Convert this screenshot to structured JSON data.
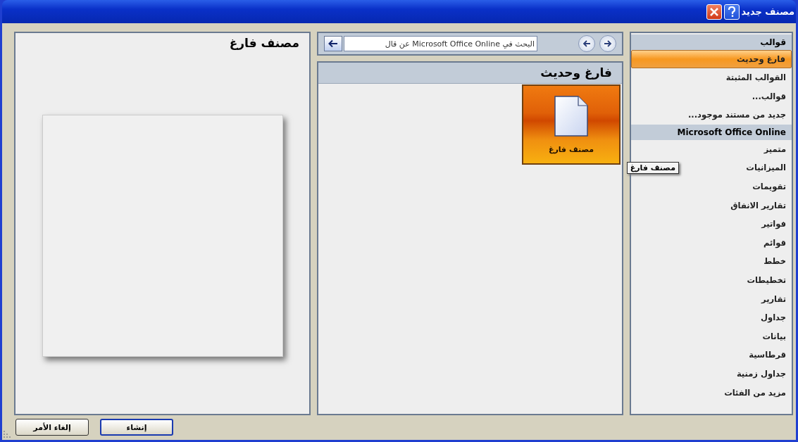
{
  "window": {
    "title": "مصنف جديد"
  },
  "sidebar": {
    "items": [
      {
        "kind": "heading",
        "label": "قوالب",
        "selected": false
      },
      {
        "kind": "item",
        "label": "فارغ وحديث",
        "selected": true
      },
      {
        "kind": "item",
        "label": "القوالب المثبتة",
        "selected": false
      },
      {
        "kind": "item",
        "label": "قوالب...",
        "selected": false
      },
      {
        "kind": "item",
        "label": "جديد من مستند موجود...",
        "selected": false
      },
      {
        "kind": "heading",
        "label": "Microsoft Office Online",
        "selected": false
      },
      {
        "kind": "item",
        "label": "متميز",
        "selected": false
      },
      {
        "kind": "item",
        "label": "الميزانيات",
        "selected": false
      },
      {
        "kind": "item",
        "label": "تقويمات",
        "selected": false
      },
      {
        "kind": "item",
        "label": "تقارير الانفاق",
        "selected": false
      },
      {
        "kind": "item",
        "label": "فواتير",
        "selected": false
      },
      {
        "kind": "item",
        "label": "قوائم",
        "selected": false
      },
      {
        "kind": "item",
        "label": "خطط",
        "selected": false
      },
      {
        "kind": "item",
        "label": "تخطيطات",
        "selected": false
      },
      {
        "kind": "item",
        "label": "تقارير",
        "selected": false
      },
      {
        "kind": "item",
        "label": "جداول",
        "selected": false
      },
      {
        "kind": "item",
        "label": "بيانات",
        "selected": false
      },
      {
        "kind": "item",
        "label": "قرطاسية",
        "selected": false
      },
      {
        "kind": "item",
        "label": "جداول زمنية",
        "selected": false
      },
      {
        "kind": "item",
        "label": "مزيد من الفئات",
        "selected": false
      }
    ]
  },
  "search": {
    "value": "البحث في Microsoft Office Online عن قال"
  },
  "gallery": {
    "heading": "فارغ وحديث",
    "tiles": [
      {
        "label": "مصنف فارغ",
        "selected": true
      }
    ]
  },
  "tooltip": {
    "text": "مصنف فارغ"
  },
  "preview": {
    "title": "مصنف فارغ"
  },
  "buttons": [
    {
      "label": "إنشاء",
      "default": true
    },
    {
      "label": "إلغاء الأمر",
      "default": false
    }
  ]
}
